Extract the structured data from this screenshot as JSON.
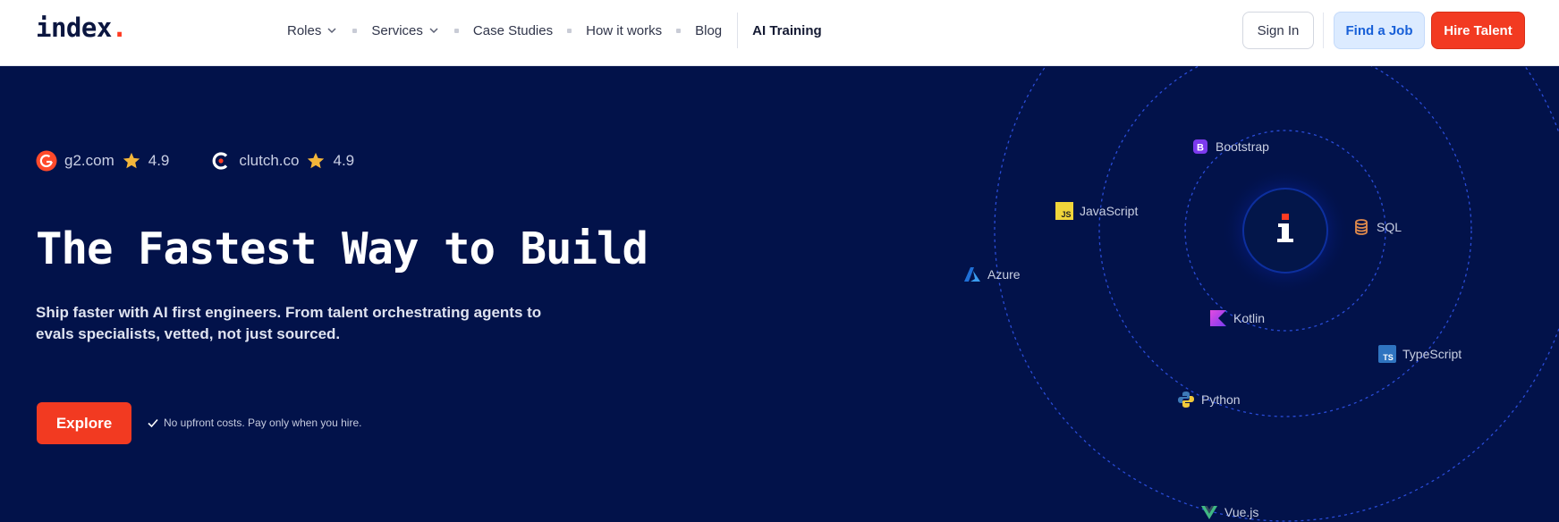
{
  "header": {
    "logo": "index",
    "logo_dot": ".",
    "nav": [
      {
        "label": "Roles",
        "has_dropdown": true
      },
      {
        "label": "Services",
        "has_dropdown": true
      },
      {
        "label": "Case Studies",
        "has_dropdown": false
      },
      {
        "label": "How it works",
        "has_dropdown": false
      },
      {
        "label": "Blog",
        "has_dropdown": false
      },
      {
        "label": "AI Training",
        "has_dropdown": false
      }
    ],
    "sign_in": "Sign In",
    "find_job": "Find a Job",
    "hire_talent": "Hire Talent"
  },
  "hero": {
    "ratings": [
      {
        "site": "g2.com",
        "score": "4.9",
        "icon": "g2-logo-icon"
      },
      {
        "site": "clutch.co",
        "score": "4.9",
        "icon": "clutch-logo-icon"
      }
    ],
    "title": "The Fastest Way to Build",
    "subtitle": "Ship faster with AI first engineers. From talent orchestrating agents to evals specialists, vetted, not just sourced.",
    "cta": "Explore",
    "note": "No upfront costs. Pay only when you hire."
  },
  "orbit": {
    "center_icon": "index-i-logo-icon",
    "technologies": [
      {
        "name": "Bootstrap",
        "icon": "bootstrap-icon"
      },
      {
        "name": "JavaScript",
        "icon": "javascript-icon"
      },
      {
        "name": "SQL",
        "icon": "database-icon"
      },
      {
        "name": "Azure",
        "icon": "azure-icon"
      },
      {
        "name": "Kotlin",
        "icon": "kotlin-icon"
      },
      {
        "name": "TypeScript",
        "icon": "typescript-icon"
      },
      {
        "name": "Python",
        "icon": "python-icon"
      },
      {
        "name": "Vue.js",
        "icon": "vue-icon"
      }
    ]
  },
  "colors": {
    "hero_bg": "#02124a",
    "accent_red": "#f23a21",
    "accent_blue": "#1860d8",
    "star": "#f4b63a"
  }
}
